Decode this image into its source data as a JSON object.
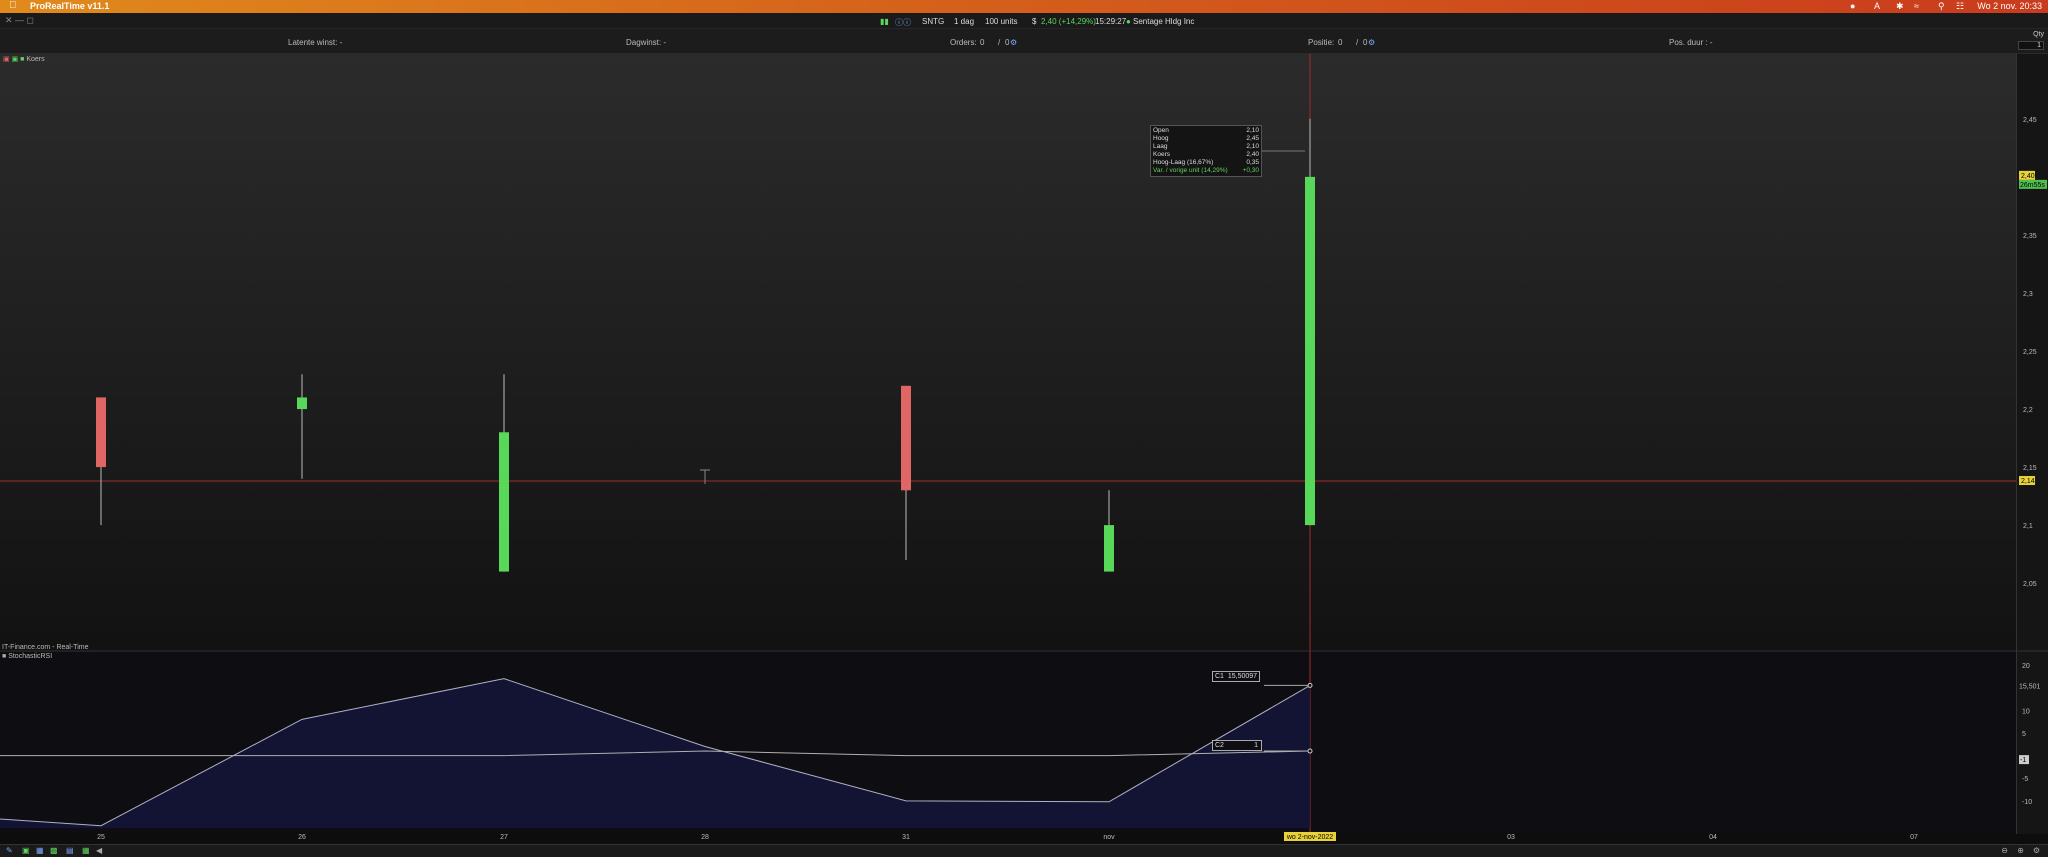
{
  "menubar": {
    "app_title": "ProRealTime v11.1",
    "clock": "Wo 2 nov. 20:33"
  },
  "toolbar": {
    "symbol": "SNTG",
    "interval": "1 dag",
    "units": "100 units",
    "currency_icon": "$",
    "price_change": "2,40 (+14,29%)",
    "time": "15:29:27",
    "company": "Sentage Hldg Inc"
  },
  "subbar": {
    "latent_gain": "Latente winst: -",
    "daily_gain": "Dagwinst: -",
    "orders_label": "Orders:",
    "orders_value": "0",
    "orders_sep": "/",
    "orders_value2": "0",
    "position_label": "Positie:",
    "position_value": "0",
    "position_sep": "/",
    "position_value2": "0",
    "pos_duration": "Pos. duur : -",
    "qty_label": "Qty",
    "qty_value": "1"
  },
  "chart": {
    "legend": "Koers",
    "source": "IT-Finance.com - Real-Time",
    "lower_indicator": "StochasticRSI",
    "current_price_label": "2,40",
    "countdown_label": "26m55s",
    "crosshair_price_label": "2,14",
    "lower_crosshair_label": "-1",
    "c1_label": "C1",
    "c1_value": "15,50097",
    "c2_label": "C2",
    "c2_value": "1",
    "c1_axis_label": "15,501",
    "date_highlight": "wo 2-nov-2022"
  },
  "tooltip": {
    "rows": [
      {
        "label": "Open",
        "value": "2,10"
      },
      {
        "label": "Hoog",
        "value": "2,45"
      },
      {
        "label": "Laag",
        "value": "2,10"
      },
      {
        "label": "Koers",
        "value": "2,40"
      },
      {
        "label": "Hoog-Laag (16,67%)",
        "value": "0,35"
      },
      {
        "label": "Var. / vorige unit (14,29%)",
        "value": "+0,30"
      }
    ]
  },
  "chart_data": {
    "type": "candlestick",
    "x_labels": [
      "25",
      "26",
      "27",
      "28",
      "31",
      "nov",
      "wo 2-nov-2022",
      "03",
      "04",
      "07"
    ],
    "y_ticks": [
      "2,45",
      "2,4",
      "2,35",
      "2,3",
      "2,25",
      "2,2",
      "2,15",
      "2,1",
      "2,05"
    ],
    "ylim": [
      2.02,
      2.48
    ],
    "candles": [
      {
        "date": "25",
        "open": 2.21,
        "high": 2.21,
        "low": 2.1,
        "close": 2.15,
        "color": "#e06666"
      },
      {
        "date": "26",
        "open": 2.2,
        "high": 2.23,
        "low": 2.14,
        "close": 2.21,
        "color": "#58d858"
      },
      {
        "date": "27",
        "open": 2.06,
        "high": 2.23,
        "low": 2.06,
        "close": 2.18,
        "color": "#58d858"
      },
      {
        "date": "31",
        "open": 2.22,
        "high": 2.22,
        "low": 2.07,
        "close": 2.13,
        "color": "#e06666"
      },
      {
        "date": "nov",
        "open": 2.06,
        "high": 2.13,
        "low": 2.06,
        "close": 2.1,
        "color": "#58d858"
      },
      {
        "date": "wo 2-nov-2022",
        "open": 2.1,
        "high": 2.45,
        "low": 2.1,
        "close": 2.4,
        "color": "#58d858"
      }
    ],
    "lower": {
      "y_ticks": [
        "20",
        "10",
        "5",
        "-5",
        "-10"
      ],
      "ylim": [
        -16,
        22
      ],
      "series": [
        {
          "name": "C1",
          "values": [
            -14,
            -15.5,
            8,
            17,
            2,
            -10,
            -10.2,
            15.5
          ]
        },
        {
          "name": "C2",
          "values": [
            0,
            0,
            0,
            0,
            1,
            0,
            0,
            1
          ]
        }
      ]
    }
  }
}
